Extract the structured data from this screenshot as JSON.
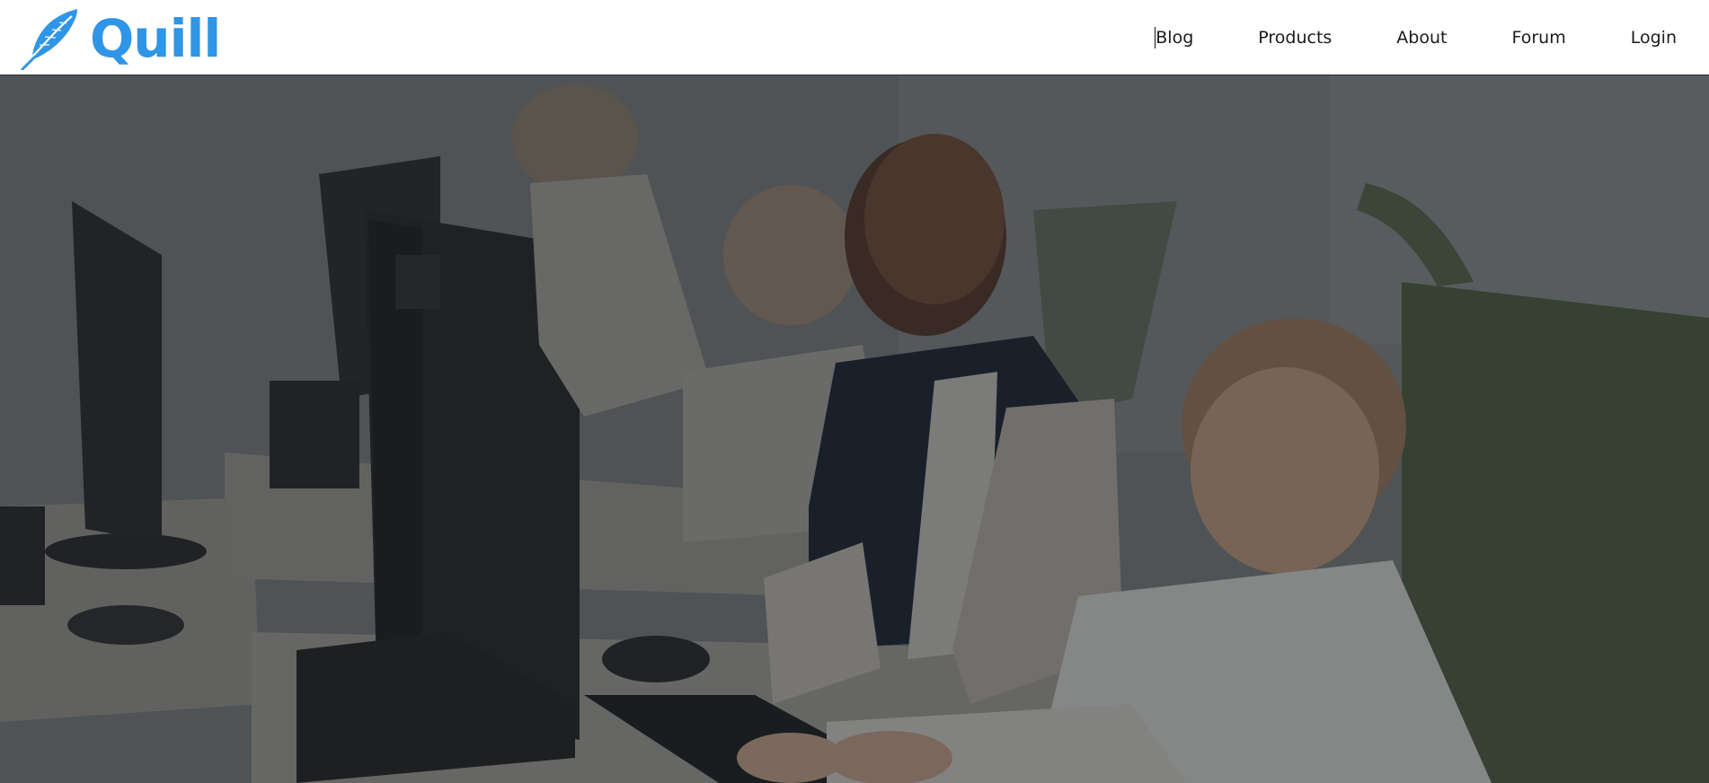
{
  "brand": {
    "name": "Quill",
    "color": "#2f95e6",
    "icon": "feather-icon"
  },
  "nav": {
    "items": [
      {
        "label": "Blog"
      },
      {
        "label": "Products"
      },
      {
        "label": "About"
      },
      {
        "label": "Forum"
      },
      {
        "label": "Login"
      }
    ]
  },
  "hero": {
    "image": "children-typing-at-computers-photo",
    "overlay_color": "#14161a"
  }
}
